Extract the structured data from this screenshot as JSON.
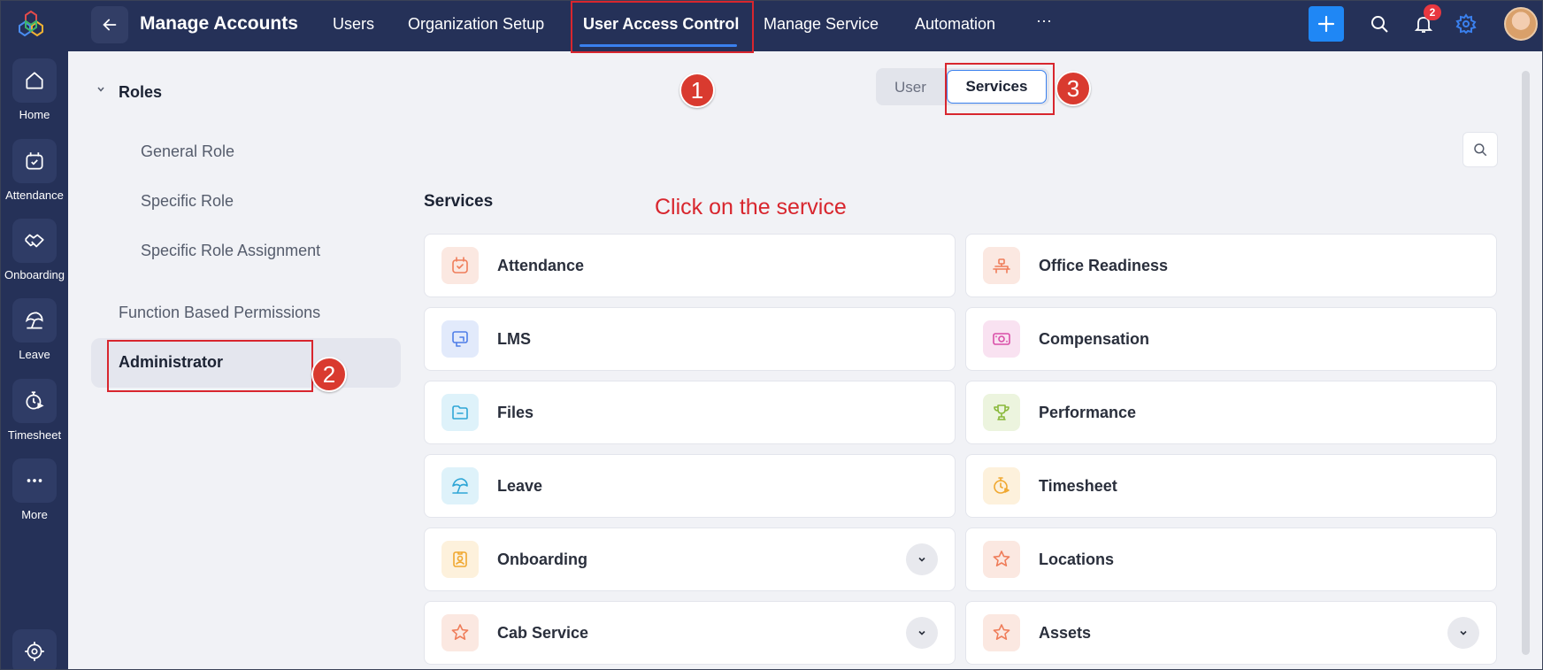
{
  "topbar": {
    "title": "Manage Accounts",
    "tabs": [
      {
        "label": "Users"
      },
      {
        "label": "Organization Setup"
      },
      {
        "label": "User Access Control"
      },
      {
        "label": "Manage Service"
      },
      {
        "label": "Automation"
      },
      {
        "label": "···"
      }
    ],
    "active_tab": "User Access Control",
    "notification_count": "2"
  },
  "rail": {
    "items": [
      {
        "label": "Home",
        "icon": "home-icon"
      },
      {
        "label": "Attendance",
        "icon": "calendar-check-icon"
      },
      {
        "label": "Onboarding",
        "icon": "handshake-icon"
      },
      {
        "label": "Leave",
        "icon": "beach-umbrella-icon"
      },
      {
        "label": "Timesheet",
        "icon": "stopwatch-icon"
      },
      {
        "label": "More",
        "icon": "more-dots-icon"
      }
    ]
  },
  "panel": {
    "roles_label": "Roles",
    "role_items": [
      {
        "label": "General Role"
      },
      {
        "label": "Specific Role"
      },
      {
        "label": "Specific Role Assignment"
      }
    ],
    "function_label": "Function Based Permissions",
    "admin_label": "Administrator"
  },
  "toggle": {
    "user_label": "User",
    "services_label": "Services"
  },
  "steps": [
    "1",
    "2",
    "3"
  ],
  "main": {
    "heading": "Services",
    "annotation": "Click on the service"
  },
  "services": [
    {
      "name": "Attendance",
      "icon": "calendar-check-icon",
      "color": "#ef7d5a",
      "bg": "#fbe8e1",
      "expandable": false
    },
    {
      "name": "Office Readiness",
      "icon": "office-desk-icon",
      "color": "#ef7d5a",
      "bg": "#fbe8e1",
      "expandable": false
    },
    {
      "name": "LMS",
      "icon": "learning-board-icon",
      "color": "#4f7ee8",
      "bg": "#e2eafb",
      "expandable": false
    },
    {
      "name": "Compensation",
      "icon": "money-note-icon",
      "color": "#d94ea8",
      "bg": "#f9e2f1",
      "expandable": false
    },
    {
      "name": "Files",
      "icon": "folder-icon",
      "color": "#2fa6d6",
      "bg": "#def2fa",
      "expandable": false
    },
    {
      "name": "Performance",
      "icon": "trophy-icon",
      "color": "#89b83a",
      "bg": "#ecf4de",
      "expandable": false
    },
    {
      "name": "Leave",
      "icon": "beach-umbrella-icon",
      "color": "#2fa6d6",
      "bg": "#def2fa",
      "expandable": false
    },
    {
      "name": "Timesheet",
      "icon": "stopwatch-icon",
      "color": "#f0a830",
      "bg": "#fdf1dc",
      "expandable": false
    },
    {
      "name": "Onboarding",
      "icon": "id-badge-icon",
      "color": "#f0a830",
      "bg": "#fdf1dc",
      "expandable": true
    },
    {
      "name": "Locations",
      "icon": "star-icon",
      "color": "#ef7d5a",
      "bg": "#fbe8e1",
      "expandable": false
    },
    {
      "name": "Cab Service",
      "icon": "star-icon",
      "color": "#ef7d5a",
      "bg": "#fbe8e1",
      "expandable": true
    },
    {
      "name": "Assets",
      "icon": "star-icon",
      "color": "#ef7d5a",
      "bg": "#fbe8e1",
      "expandable": true
    }
  ],
  "colors": {
    "nav_bg": "#253158",
    "accent": "#1f87f5",
    "highlight": "#d8262e"
  }
}
